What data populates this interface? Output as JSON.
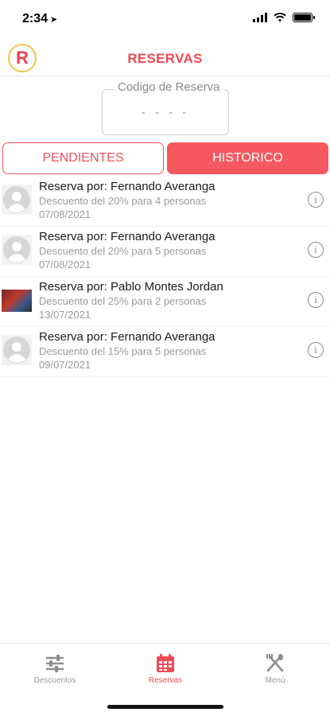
{
  "status": {
    "time": "2:34",
    "location_glyph": "➤"
  },
  "header": {
    "title": "RESERVAS",
    "logo_letter": "R"
  },
  "code": {
    "label": "Codigo de Reserva",
    "placeholder": "- - - -"
  },
  "segments": {
    "pending": "PENDIENTES",
    "history": "HISTORICO"
  },
  "reservations": [
    {
      "title": "Reserva por: Fernando Averanga",
      "subtitle": "Descuento del 20% para 4 personas",
      "date": "07/08/2021",
      "avatar": "default"
    },
    {
      "title": "Reserva por: Fernando Averanga",
      "subtitle": "Descuento del 20% para 5 personas",
      "date": "07/08/2021",
      "avatar": "default"
    },
    {
      "title": "Reserva por: Pablo Montes Jordan",
      "subtitle": "Descuento del 25% para 2 personas",
      "date": "13/07/2021",
      "avatar": "photo"
    },
    {
      "title": "Reserva por: Fernando Averanga",
      "subtitle": "Descuento del 15% para 5 personas",
      "date": "09/07/2021",
      "avatar": "default"
    }
  ],
  "info_glyph": "i",
  "tabbar": {
    "tab1": {
      "label": "Descuentos",
      "icon": "sliders-icon"
    },
    "tab2": {
      "label": "Reservas",
      "icon": "calendar-icon"
    },
    "tab3": {
      "label": "Menú",
      "icon": "utensils-icon"
    }
  },
  "colors": {
    "accent": "#f04a55",
    "segment_active": "#f6585f",
    "muted": "#9b9b9b"
  }
}
